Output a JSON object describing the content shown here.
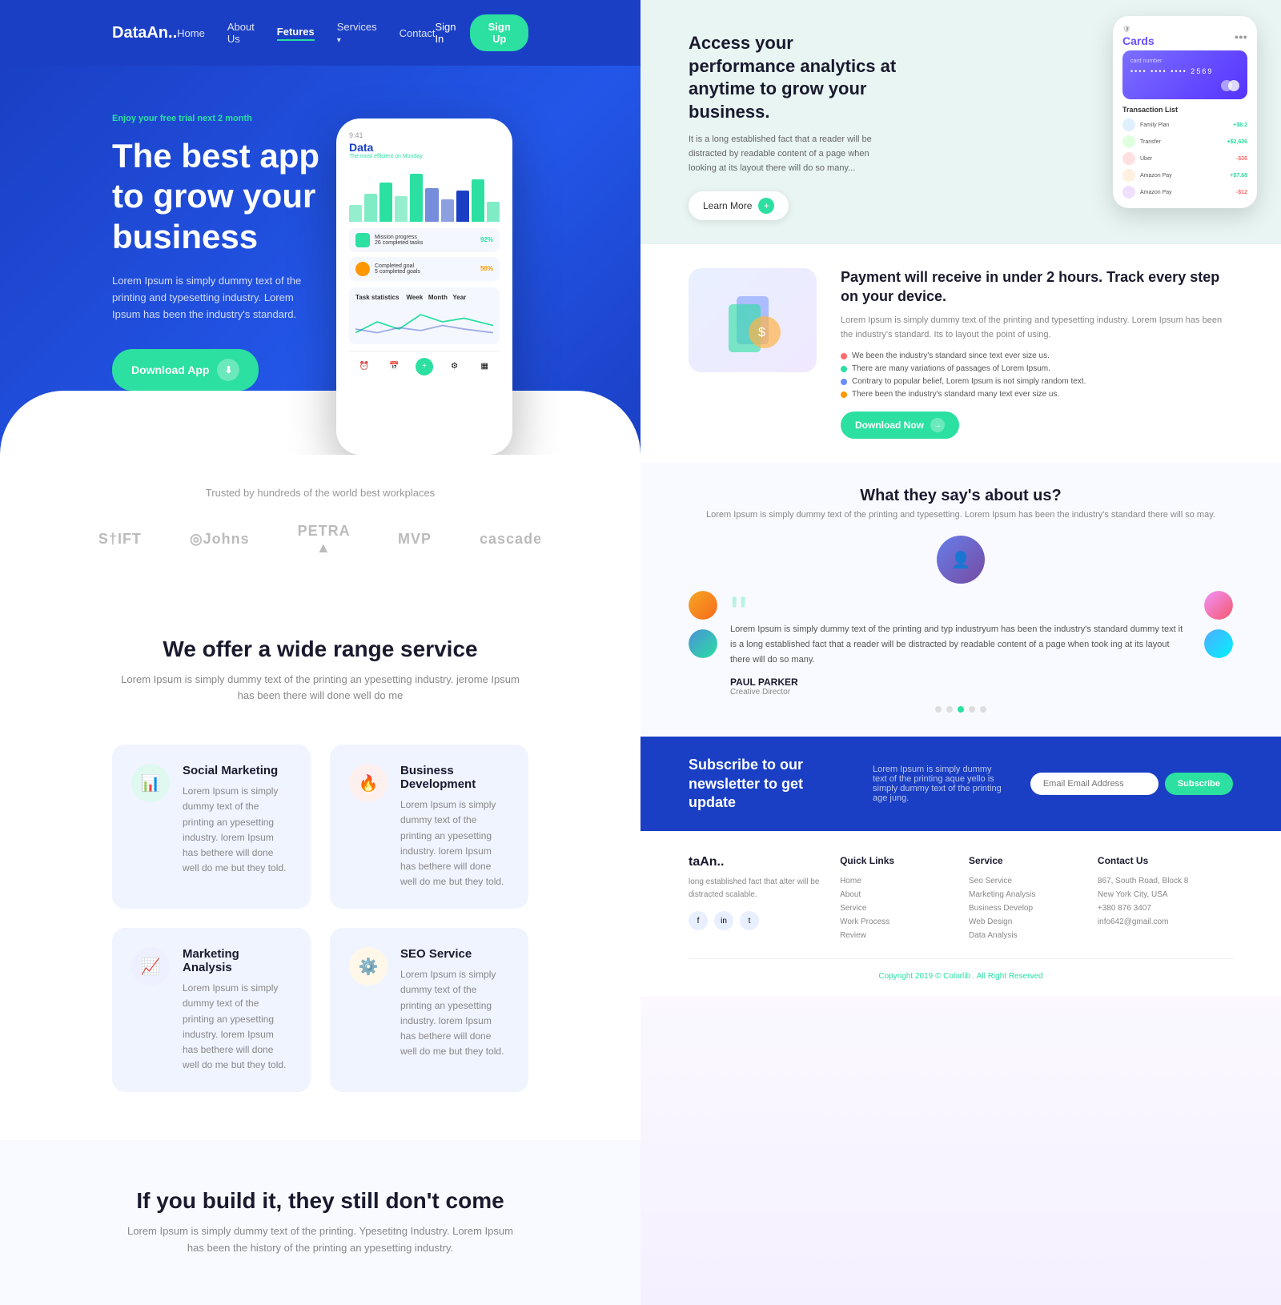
{
  "brand": "DataAn..",
  "nav": {
    "links": [
      "Home",
      "About Us",
      "Fetures",
      "Services",
      "Contact"
    ],
    "active": "Fetures",
    "has_arrow": [
      "Services"
    ],
    "signin": "Sign In",
    "signup": "Sign Up"
  },
  "hero": {
    "trial": "Enjoy your free trial ",
    "trial_highlight": "next 2 month",
    "title": "The best app to grow your business",
    "desc": "Lorem Ipsum is simply dummy text of the printing and typesetting industry. Lorem Ipsum has been the industry's standard.",
    "cta": "Download App"
  },
  "trusted": {
    "label": "Trusted by hundreds of the world best workplaces",
    "logos": [
      "STIFT",
      "◎Johns",
      "PETRA ▲",
      "MVP",
      "cascade"
    ]
  },
  "services": {
    "title": "We offer a wide range service",
    "desc": "Lorem Ipsum is simply dummy text of the printing an ypesetting industry. jerome Ipsum has been there will done well do me",
    "items": [
      {
        "title": "Social Marketing",
        "desc": "Lorem Ipsum is simply dummy text of the printing an ypesetting industry. lorem Ipsum has bethere will done well do me but they told.",
        "icon": "📊",
        "bg": "#2be0a0"
      },
      {
        "title": "Business Development",
        "desc": "Lorem Ipsum is simply dummy text of the printing an ypesetting industry. lorem Ipsum has bethere will done well do me but they told.",
        "icon": "🔥",
        "bg": "#ff6b6b"
      },
      {
        "title": "Marketing Analysis",
        "desc": "Lorem Ipsum is simply dummy text of the printing an ypesetting industry. lorem Ipsum has bethere will done well do me but they told.",
        "icon": "📈",
        "bg": "#6b8cff"
      },
      {
        "title": "SEO Service",
        "desc": "Lorem Ipsum is simply dummy text of the printing an ypesetting industry. lorem Ipsum has bethere will done well do me but they told.",
        "icon": "⚙️",
        "bg": "#ffb347"
      }
    ]
  },
  "build": {
    "title": "If you build it, they still don't come",
    "desc": "Lorem Ipsum is simply dummy text of the printing. Ypesetitng Industry. Lorem Ipsum has been the history of the printing an ypesetting industry."
  },
  "analytics": {
    "title": "Access your performance analytics at anytime to grow your business.",
    "desc": "It is a long established fact that a reader will be distracted by readable content of a page when looking at its layout there will do so many...",
    "cta": "Learn More",
    "card": {
      "label": "Cards",
      "number": "**** **** **** 2569",
      "section_title": "Transaction List",
      "transactions": [
        {
          "name": "Family Plan",
          "amount": "+$8.2",
          "positive": true
        },
        {
          "name": "Transfer",
          "amount": "+$2,606",
          "positive": true
        },
        {
          "name": "Uber",
          "amount": "-$36",
          "positive": false
        },
        {
          "name": "Amazon Pay",
          "amount": "+$7.68",
          "positive": true
        },
        {
          "name": "Amazon Pay",
          "amount": "-$12",
          "positive": false
        }
      ]
    }
  },
  "payment": {
    "title": "Payment will receive in under 2 hours. Track every step on your device.",
    "desc": "Lorem Ipsum is simply dummy text of the printing and typesetting industry. Lorem Ipsum has been the industry's standard. Its to layout the point of using.",
    "checks": [
      "We been the industry's standard since text ever size us.",
      "There are many variations of passages of Lorem Ipsum.",
      "Contrary to popular belief, Lorem Ipsum is not simply random text.",
      "There been the industry's standard many text ever size us."
    ],
    "cta": "Download Now"
  },
  "testimonials": {
    "title": "What they say's about us?",
    "desc": "Lorem Ipsum is simply dummy text of the printing and typesetting. Lorem Ipsum has been the industry's standard there will so may.",
    "quote": "Lorem Ipsum is simply dummy text of the printing and typ industryum has been the industry's standard dummy text it is a long established fact that a reader will be distracted by readable content of a page when took ing at its layout there will do so many.",
    "author": "PAUL PARKER",
    "author_title": "Creative Director",
    "dots": [
      false,
      false,
      true,
      false,
      false
    ]
  },
  "newsletter": {
    "title": "Subscribe to our newsletter to get update",
    "desc": "Lorem Ipsum is simply dummy text of the printing aque yello is simply dummy text of the printing age jung.",
    "placeholder": "Email Email Address",
    "cta": "Subscribe"
  },
  "footer": {
    "brand": "taAn..",
    "brand_desc": "long established fact that alter will be distracted scalable.",
    "social_icons": [
      "f",
      "in",
      "t"
    ],
    "quick_links": {
      "title": "Quick Links",
      "items": [
        "Home",
        "About",
        "Service",
        "Work Process",
        "Review"
      ]
    },
    "services_links": {
      "title": "Service",
      "items": [
        "Seo Service",
        "Marketing Analysis",
        "Business Develop",
        "Web Design",
        "Data Analysis"
      ]
    },
    "contact": {
      "title": "Contact Us",
      "address": "867, South Road, Block 8",
      "city": "New York City, USA",
      "phone": "+380 876 3407",
      "email": "info642@gmail.com"
    },
    "copy": "Copyright 2019 ©",
    "copy_brand": "Colorlib",
    "copy_end": ". All Right Reserved"
  }
}
